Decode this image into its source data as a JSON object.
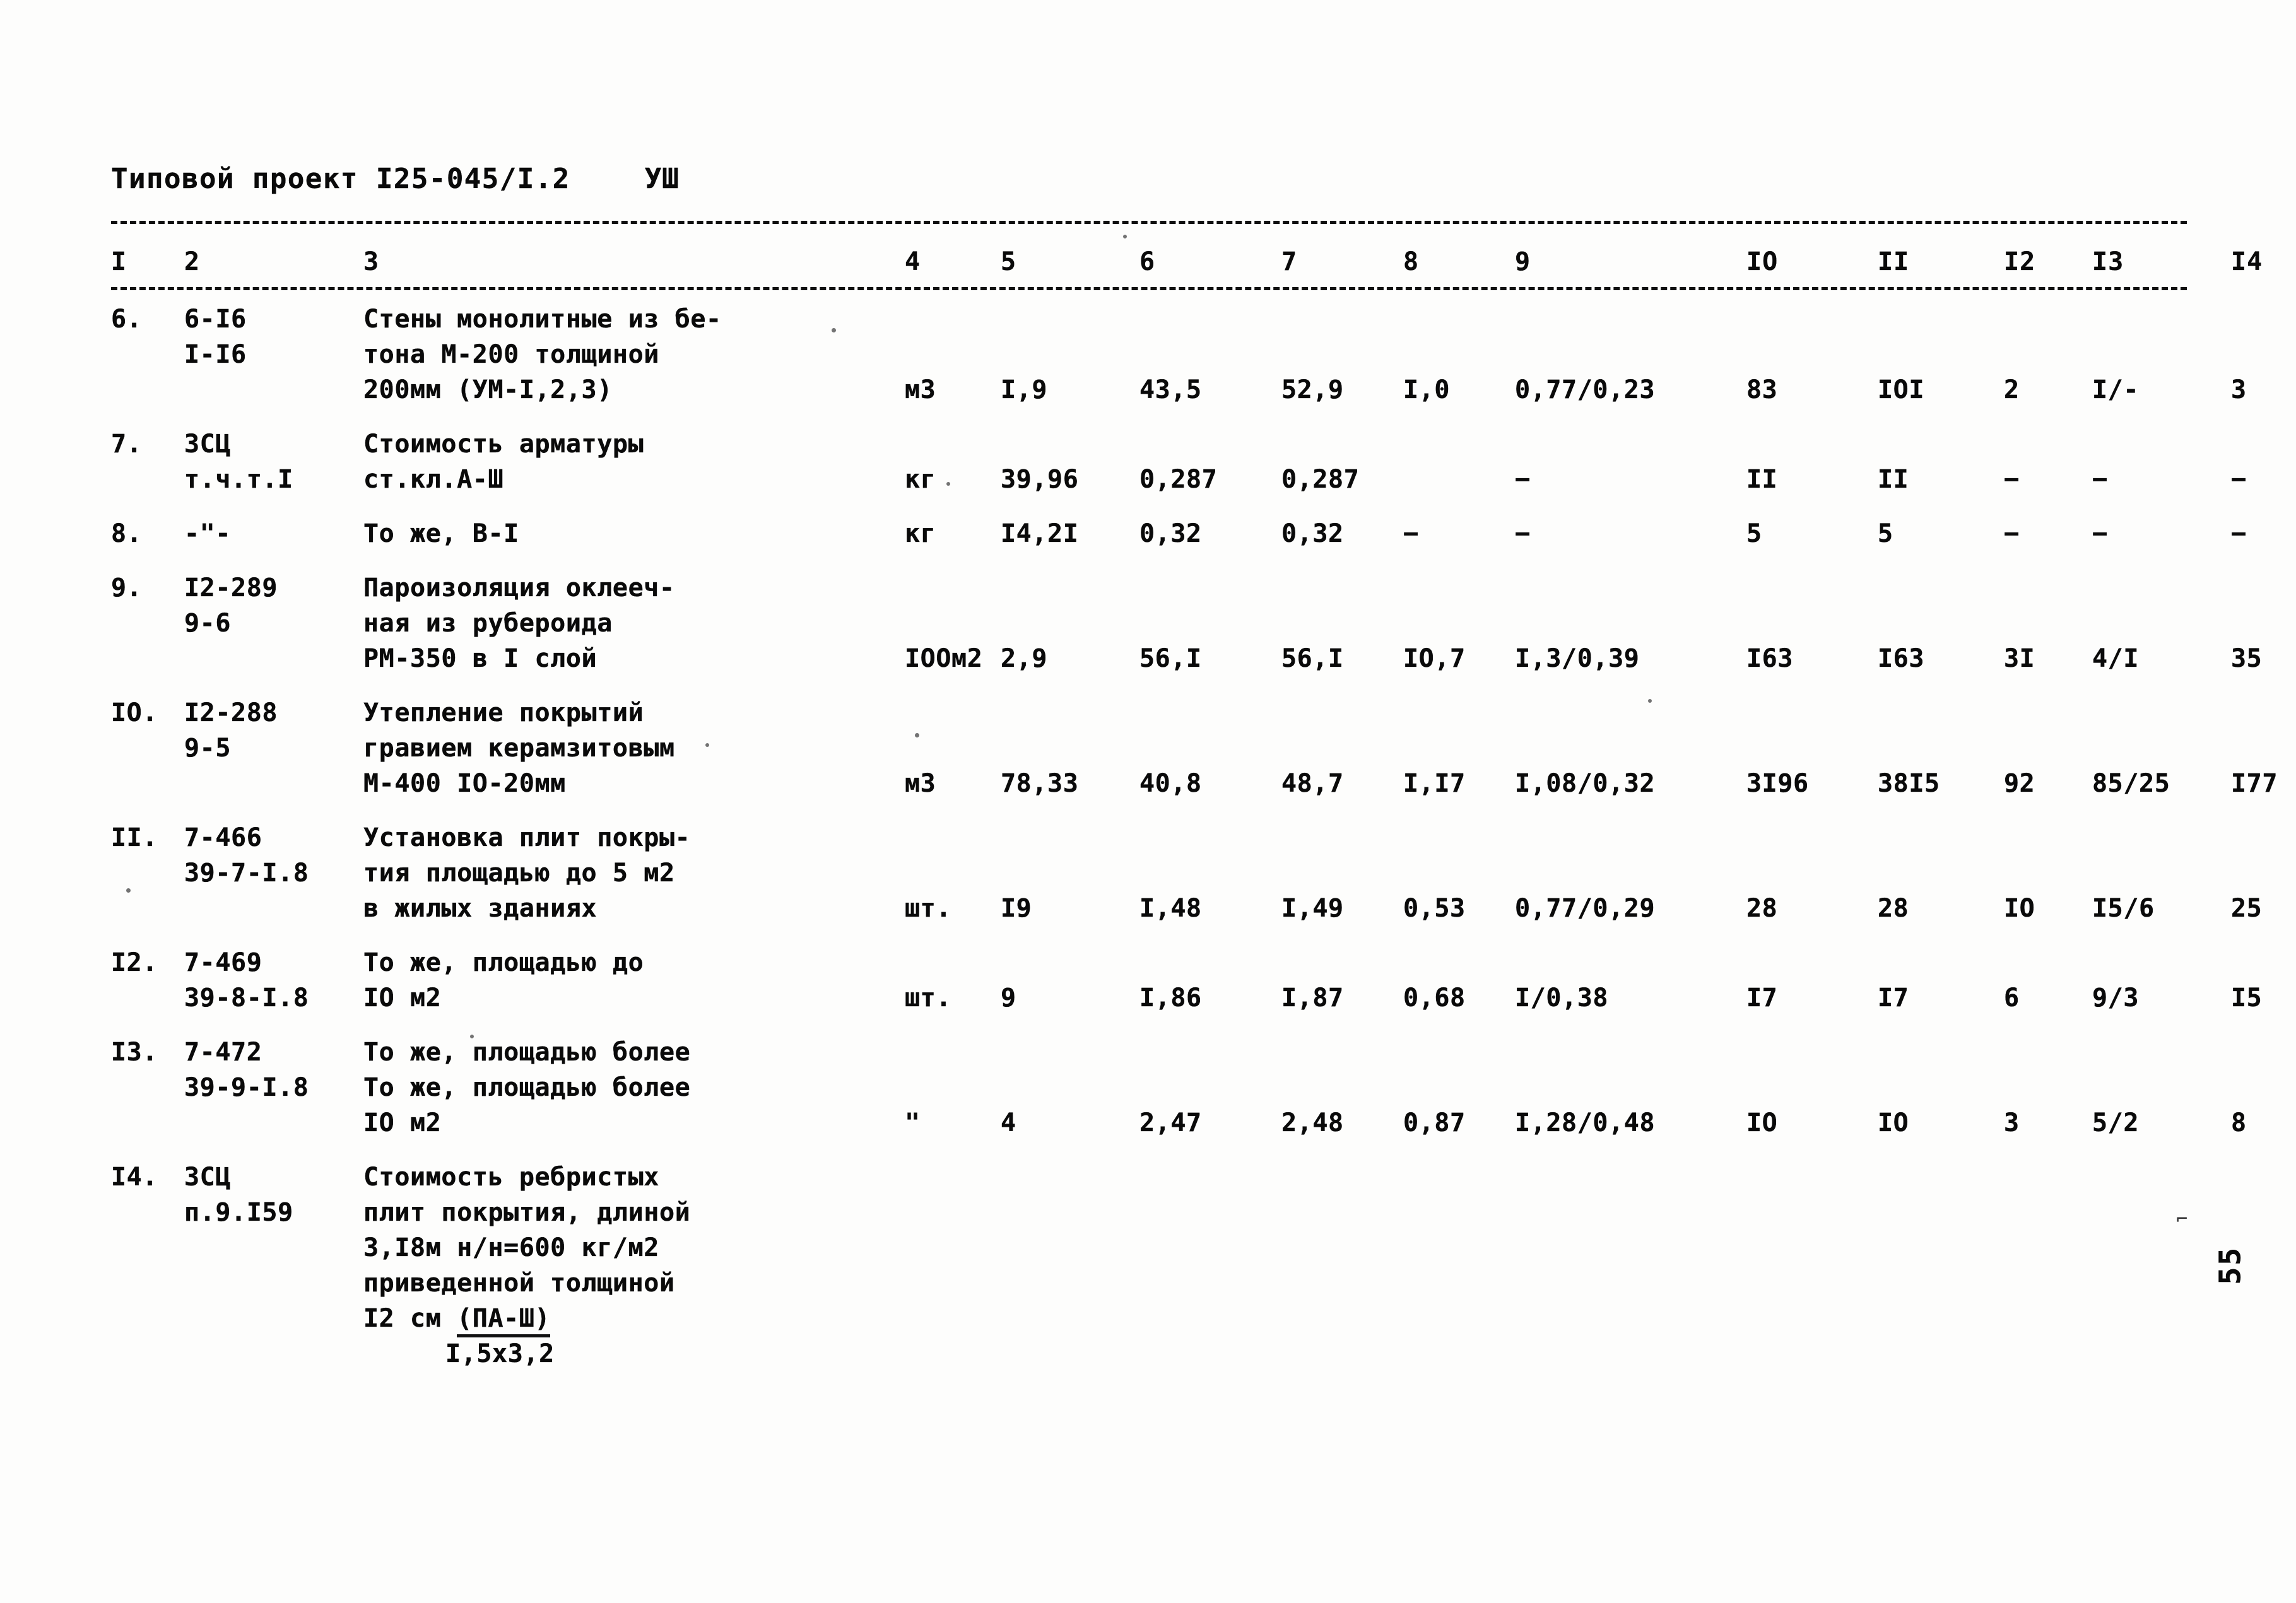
{
  "document": {
    "title": "Типовой проект I25-045/I.2",
    "section_marker": "УШ",
    "page_number": "55"
  },
  "table": {
    "column_headers": [
      "I",
      "2",
      "3",
      "4",
      "5",
      "6",
      "7",
      "8",
      "9",
      "IO",
      "II",
      "I2",
      "I3",
      "I4"
    ],
    "rows": [
      {
        "num": "6.",
        "code_lines": [
          "6-I6",
          "I-I6"
        ],
        "desc_lines": [
          "Стены монолитные из бе-",
          "тона М-200 толщиной",
          "200мм (УМ-I,2,3)"
        ],
        "unit": "мЗ",
        "qty": "I,9",
        "v6": "43,5",
        "v7": "52,9",
        "v8": "I,0",
        "v9": "0,77/0,23",
        "v10": "83",
        "v11": "IOI",
        "v12": "2",
        "v13": "I/-",
        "v14": "3"
      },
      {
        "num": "7.",
        "code_lines": [
          "ЗСЦ",
          "т.ч.т.I"
        ],
        "desc_lines": [
          "Стоимость арматуры",
          "ст.кл.А-Ш"
        ],
        "unit": "кг",
        "qty": "39,96",
        "v6": "0,287",
        "v7": "0,287",
        "v8": "",
        "v9": "−",
        "v10": "II",
        "v11": "II",
        "v12": "−",
        "v13": "−",
        "v14": "−"
      },
      {
        "num": "8.",
        "code_lines": [
          "-\"-"
        ],
        "desc_lines": [
          "То же, В-I"
        ],
        "unit": "кг",
        "qty": "I4,2I",
        "v6": "0,32",
        "v7": "0,32",
        "v8": "−",
        "v9": "−",
        "v10": "5",
        "v11": "5",
        "v12": "−",
        "v13": "−",
        "v14": "−"
      },
      {
        "num": "9.",
        "code_lines": [
          "I2-289",
          "9-6"
        ],
        "desc_lines": [
          "Пароизоляция оклееч-",
          "ная из рубероида",
          "РМ-350 в I слой"
        ],
        "unit": "IOOм2",
        "qty": "2,9",
        "v6": "56,I",
        "v7": "56,I",
        "v8": "IO,7",
        "v9": "I,3/0,39",
        "v10": "I63",
        "v11": "I63",
        "v12": "3I",
        "v13": "4/I",
        "v14": "35"
      },
      {
        "num": "IO.",
        "code_lines": [
          "I2-288",
          "9-5"
        ],
        "desc_lines": [
          "Утепление покрытий",
          "гравием керамзитовым",
          "М-400 IO-20мм"
        ],
        "unit": "мЗ",
        "qty": "78,33",
        "v6": "40,8",
        "v7": "48,7",
        "v8": "I,I7",
        "v9": "I,08/0,32",
        "v10": "3I96",
        "v11": "38I5",
        "v12": "92",
        "v13": "85/25",
        "v14": "I77"
      },
      {
        "num": "II.",
        "code_lines": [
          "7-466",
          "39-7-I.8"
        ],
        "desc_lines": [
          "Установка плит покры-",
          "тия площадью до 5 м2",
          "в жилых зданиях"
        ],
        "unit": "шт.",
        "qty": "I9",
        "v6": "I,48",
        "v7": "I,49",
        "v8": "0,53",
        "v9": "0,77/0,29",
        "v10": "28",
        "v11": "28",
        "v12": "IO",
        "v13": "I5/6",
        "v14": "25"
      },
      {
        "num": "I2.",
        "code_lines": [
          "7-469",
          "39-8-I.8"
        ],
        "desc_lines": [
          "То же, площадью до",
          "IO м2"
        ],
        "unit": "шт.",
        "qty": "9",
        "v6": "I,86",
        "v7": "I,87",
        "v8": "0,68",
        "v9": "I/0,38",
        "v10": "I7",
        "v11": "I7",
        "v12": "6",
        "v13": "9/3",
        "v14": "I5"
      },
      {
        "num": "I3.",
        "code_lines": [
          "7-472",
          "39-9-I.8"
        ],
        "desc_lines": [
          "То же, площадью более",
          "То же, площадью более",
          "IO м2"
        ],
        "unit": "\"",
        "qty": "4",
        "v6": "2,47",
        "v7": "2,48",
        "v8": "0,87",
        "v9": "I,28/0,48",
        "v10": "IO",
        "v11": "IO",
        "v12": "3",
        "v13": "5/2",
        "v14": "8"
      },
      {
        "num": "I4.",
        "code_lines": [
          "ЗСЦ",
          "п.9.I59"
        ],
        "desc_lines": [
          "Стоимость ребристых",
          "плит покрытия, длиной",
          "3,I8м н/н=600 кг/м2",
          "приведенной толщиной",
          "I2 см (ПА-Ш)"
        ],
        "desc_underline_last": true,
        "desc_sub": "I,5х3,2",
        "unit": "",
        "qty": "",
        "v6": "",
        "v7": "",
        "v8": "",
        "v9": "",
        "v10": "",
        "v11": "",
        "v12": "",
        "v13": "",
        "v14": ""
      }
    ]
  }
}
